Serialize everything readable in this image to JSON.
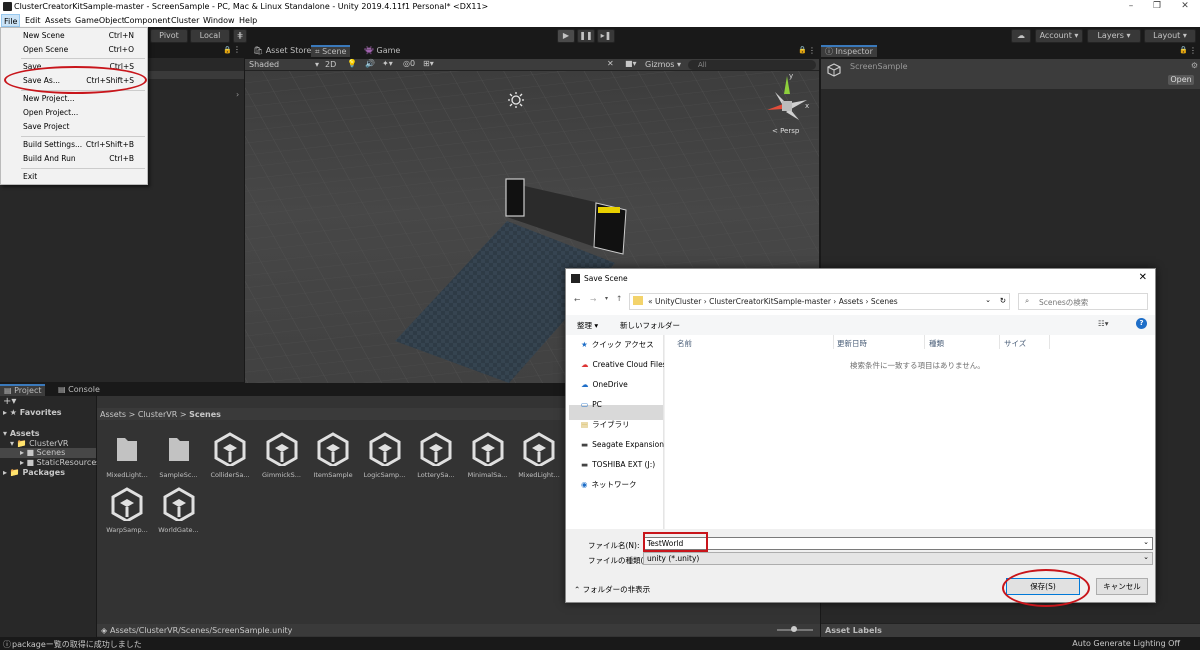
{
  "window": {
    "title": "ClusterCreatorKitSample-master - ScreenSample - PC, Mac & Linux Standalone - Unity 2019.4.11f1 Personal* <DX11>"
  },
  "menubar": {
    "items": [
      "File",
      "Edit",
      "Assets",
      "GameObject",
      "Component",
      "Cluster",
      "Window",
      "Help"
    ]
  },
  "file_menu": {
    "items": [
      {
        "label": "New Scene",
        "shortcut": "Ctrl+N"
      },
      {
        "label": "Open Scene",
        "shortcut": "Ctrl+O"
      },
      {
        "label": "Save",
        "shortcut": "Ctrl+S"
      },
      {
        "label": "Save As...",
        "shortcut": "Ctrl+Shift+S"
      },
      {
        "label": "New Project...",
        "shortcut": ""
      },
      {
        "label": "Open Project...",
        "shortcut": ""
      },
      {
        "label": "Save Project",
        "shortcut": ""
      },
      {
        "label": "Build Settings...",
        "shortcut": "Ctrl+Shift+B"
      },
      {
        "label": "Build And Run",
        "shortcut": "Ctrl+B"
      },
      {
        "label": "Exit",
        "shortcut": ""
      }
    ]
  },
  "toolbar": {
    "pivot": "Pivot",
    "local": "Local",
    "account": "Account",
    "layers": "Layers",
    "layout": "Layout"
  },
  "scene_tabs": [
    "Asset Store",
    "Scene",
    "Game"
  ],
  "scene_toolbar": {
    "shading": "Shaded",
    "mode_2d": "2D",
    "gizmos": "Gizmos",
    "search_placeholder": "All",
    "persp": "< Persp"
  },
  "inspector": {
    "tab": "Inspector",
    "object": "ScreenSample",
    "open_button": "Open",
    "asset_labels": "Asset Labels",
    "auto_lighting": "Auto Generate Lighting Off"
  },
  "project": {
    "tabs": [
      "Project",
      "Console"
    ],
    "favorites": "Favorites",
    "tree": {
      "assets": "Assets",
      "clustervr": "ClusterVR",
      "scenes": "Scenes",
      "static": "StaticResources",
      "packages": "Packages"
    },
    "breadcrumb": [
      "Assets",
      "ClusterVR",
      "Scenes"
    ],
    "assets": [
      "MixedLight...",
      "SampleSc...",
      "ColliderSa...",
      "GimmickS...",
      "ItemSample",
      "LogicSamp...",
      "LotterySa...",
      "MinimalSa...",
      "MixedLight...",
      "WarpSamp...",
      "WorldGate..."
    ],
    "path": "Assets/ClusterVR/Scenes/ScreenSample.unity"
  },
  "status_bar": {
    "message": "packageー覧の取得に成功しました"
  },
  "dialog": {
    "title": "Save Scene",
    "path": [
      "UnityCluster",
      "ClusterCreatorKitSample-master",
      "Assets",
      "Scenes"
    ],
    "search_placeholder": "Scenesの検索",
    "organize": "整理 ▾",
    "new_folder": "新しいフォルダー",
    "nav": [
      "クイック アクセス",
      "Creative Cloud Files",
      "OneDrive",
      "PC",
      "ライブラリ",
      "Seagate Expansion D",
      "TOSHIBA EXT (J:)",
      "ネットワーク"
    ],
    "columns": [
      "名前",
      "更新日時",
      "種類",
      "サイズ"
    ],
    "empty_message": "検索条件に一致する項目はありません。",
    "filename_label": "ファイル名(N):",
    "filename": "TestWorld",
    "filetype_label": "ファイルの種類(T):",
    "filetype": "unity (*.unity)",
    "hide_folders": "フォルダーの非表示",
    "save_button": "保存(S)",
    "cancel_button": "キャンセル"
  }
}
